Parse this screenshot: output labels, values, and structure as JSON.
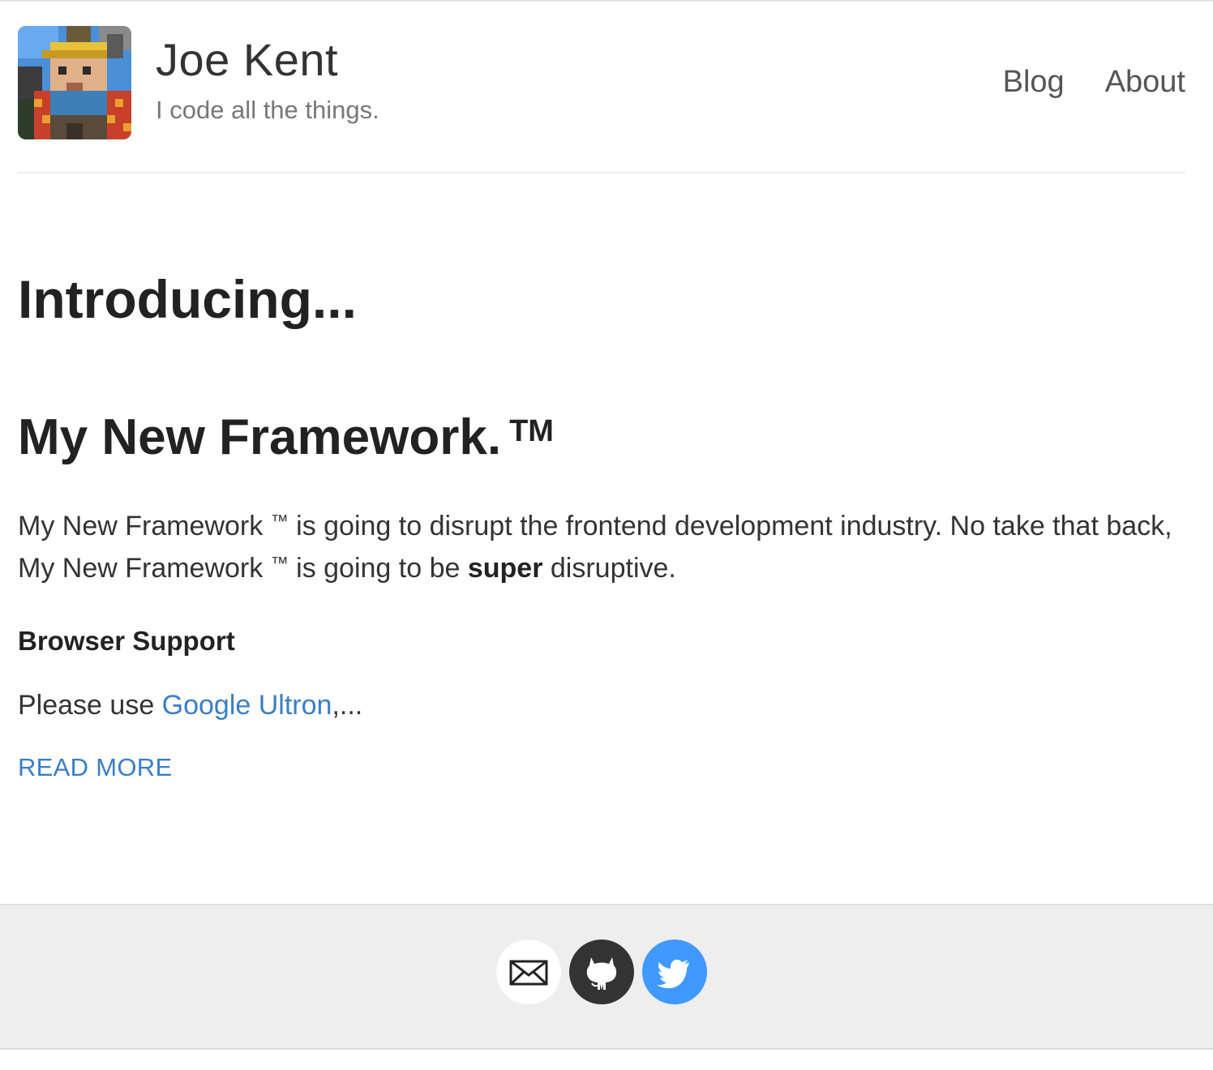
{
  "site": {
    "title": "Joe Kent",
    "tagline": "I code all the things."
  },
  "nav": {
    "blog": "Blog",
    "about": "About"
  },
  "page": {
    "heading": "Introducing..."
  },
  "post": {
    "title": "My New Framework.",
    "title_mark": "TM",
    "excerpt_part1": "My New Framework ",
    "excerpt_tm1": "™",
    "excerpt_part2": " is going to disrupt the frontend development industry. No take that back, My New Framework ",
    "excerpt_tm2": "™",
    "excerpt_part3": " is going to be ",
    "excerpt_bold": "super",
    "excerpt_part4": " disruptive.",
    "subheading": "Browser Support",
    "support_prefix": "Please use ",
    "support_link": "Google Ultron",
    "support_suffix": ",...",
    "read_more": "READ MORE"
  },
  "social": {
    "icons": [
      "email-icon",
      "github-icon",
      "twitter-icon"
    ],
    "colors": {
      "email": "#ffffff",
      "github": "#333333",
      "twitter": "#4099ff"
    }
  },
  "colors": {
    "link": "#3a7ec6",
    "footer_background": "#eeeeee"
  }
}
